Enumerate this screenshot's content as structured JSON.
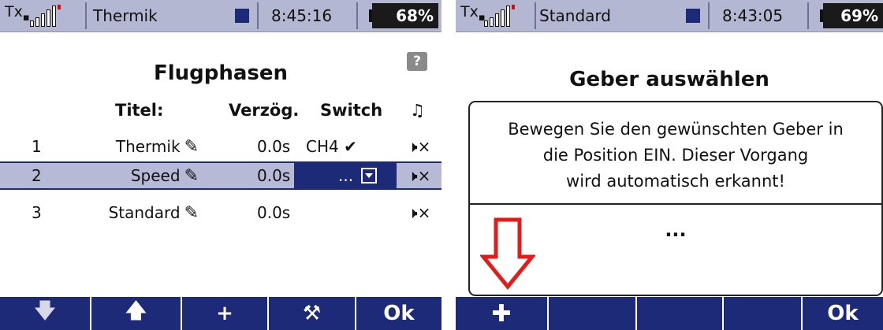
{
  "left_screen": {
    "status": {
      "tx": "Tx",
      "phase": "Thermik",
      "time": "8:45:16",
      "battery": "68%"
    },
    "title": "Flugphasen",
    "help": "?",
    "headers": {
      "title": "Titel:",
      "delay": "Verzög.",
      "switch": "Switch",
      "sound_icon": "♫"
    },
    "rows": [
      {
        "num": "1",
        "name": "Thermik",
        "delay": "0.0s",
        "switch": "CH4 ✔",
        "selected": false
      },
      {
        "num": "2",
        "name": "Speed",
        "delay": "0.0s",
        "switch": "...",
        "selected": true
      },
      {
        "num": "3",
        "name": "Standard",
        "delay": "0.0s",
        "switch": "",
        "selected": false
      }
    ],
    "edit_icon": "✎",
    "speaker_icon": "🕨×",
    "bottom": [
      "🡇",
      "🡅",
      "+",
      "⚒",
      "Ok"
    ]
  },
  "right_screen": {
    "status": {
      "tx": "Tx",
      "phase": "Standard",
      "time": "8:43:05",
      "battery": "69%"
    },
    "title": "Geber auswählen",
    "message": [
      "Bewegen Sie den gewünschten Geber in",
      "die Position EIN. Dieser Vorgang",
      "wird automatisch erkannt!"
    ],
    "placeholder": "...",
    "bottom": [
      "✚",
      "",
      "",
      "",
      "Ok"
    ]
  },
  "colors": {
    "status_bg": "#b4b7d2",
    "accent": "#1c2a78",
    "arrow": "#e31b1b"
  }
}
